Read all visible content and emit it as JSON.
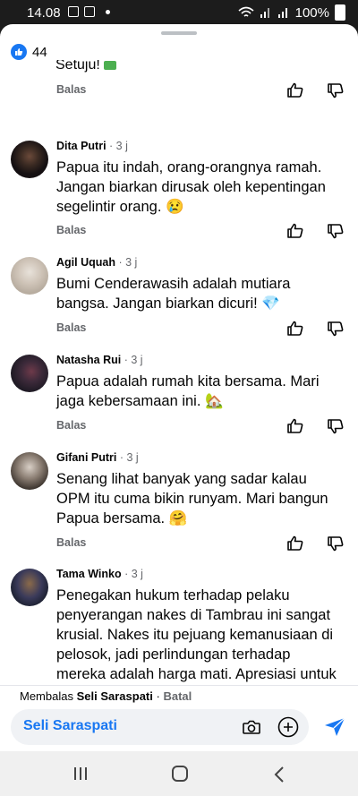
{
  "status_bar": {
    "time": "14.08",
    "battery": "100%"
  },
  "header": {
    "like_count": "44"
  },
  "cropped_comment": {
    "text": "Setuju!"
  },
  "labels": {
    "reply": "Balas"
  },
  "comments": [
    {
      "author": "Dita Putri",
      "time": "· 3 j",
      "text": "Papua itu indah, orang-orangnya ramah. Jangan biarkan dirusak oleh kepentingan segelintir orang. 😢",
      "reply": "Balas"
    },
    {
      "author": "Agil Uquah",
      "time": "· 3 j",
      "text": "Bumi Cenderawasih adalah mutiara bangsa. Jangan biarkan dicuri! 💎",
      "reply": "Balas"
    },
    {
      "author": "Natasha Rui",
      "time": "· 3 j",
      "text": "Papua adalah rumah kita bersama. Mari jaga kebersamaan ini. 🏡",
      "reply": "Balas"
    },
    {
      "author": "Gifani Putri",
      "time": "· 3 j",
      "text": "Senang lihat banyak yang sadar kalau OPM itu cuma bikin runyam. Mari bangun Papua bersama. 🤗",
      "reply": "Balas"
    },
    {
      "author": "Tama Winko",
      "time": "· 3 j",
      "text": "Penegakan hukum terhadap pelaku penyerangan nakes di Tambrau ini sangat krusial. Nakes itu pejuang kemanusiaan di pelosok, jadi perlindungan terhadap mereka adalah harga mati. Apresiasi untuk Satgas Damai Cartenz yang bergerak cepat"
    }
  ],
  "reply_bar": {
    "prefix": "Membalas",
    "target": "Seli Saraspati",
    "separator": "·",
    "cancel": "Batal",
    "input_value": "Seli Saraspati"
  },
  "colors": {
    "accent": "#1877f2",
    "secondary_text": "#65676b"
  }
}
